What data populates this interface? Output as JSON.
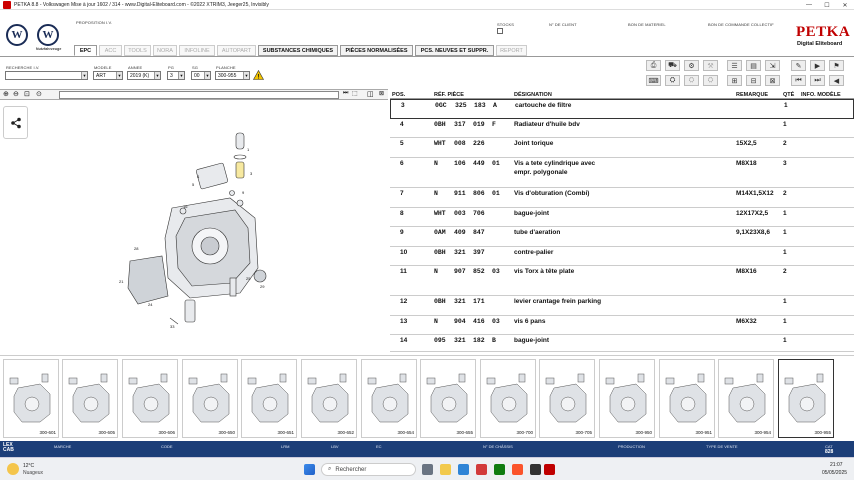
{
  "window": {
    "title": "PETKA 8.8 - Volkswagen Mise à jour 1602 / 314 - www.Digital-Eliteboard.com - ©2022 XTRIM3, Jeeger25, Invisibly"
  },
  "header": {
    "brand_name": "PETKA",
    "brand_sub": "Digital Eliteboard",
    "vw_sub": "Nutzfahrzeuge",
    "proposition": "PROPOSITION I.V.",
    "stocks": "STOCKS",
    "client_no": "N° DE CLIENT",
    "bon_materiel": "BON DE MATERIEL",
    "bon_commande": "BON DE COMMANDE COLLECTIF"
  },
  "tabs": [
    {
      "label": "EPC",
      "state": "active"
    },
    {
      "label": "ACC",
      "state": "disabled"
    },
    {
      "label": "TOOLS",
      "state": "disabled"
    },
    {
      "label": "NORA",
      "state": "disabled"
    },
    {
      "label": "INFOLINE",
      "state": "disabled"
    },
    {
      "label": "AUTOPART",
      "state": "disabled"
    },
    {
      "label": "SUBSTANCES CHIMIQUES",
      "state": "normal"
    },
    {
      "label": "PIÈCES NORMALISÉES",
      "state": "normal"
    },
    {
      "label": "PCS. NEUVES ET SUPPR.",
      "state": "normal"
    },
    {
      "label": "REPORT",
      "state": "disabled"
    }
  ],
  "filters": {
    "recherche_label": "RECHERCHE I.V.",
    "modele_label": "MODELE",
    "modele_value": "ART",
    "annee_label": "ANNEE",
    "annee_value": "2019 (K)",
    "pg_label": "PG",
    "pg_value": "3",
    "sg_label": "SG",
    "sg_value": "00",
    "planche_label": "PLANCHE",
    "planche_value": "300-955"
  },
  "table": {
    "headers": {
      "pos": "POS.",
      "ref": "RÉF. PIÈCE",
      "designation": "DÉSIGNATION",
      "remarque": "REMARQUE",
      "qte": "QTÉ",
      "info": "INFO. MODÈLE"
    },
    "rows": [
      {
        "pos": "3",
        "r1": "0GC",
        "r2": "325",
        "r3": "183",
        "r4": "A",
        "des": "cartouche de filtre",
        "des2": "",
        "rem": "",
        "qte": "1"
      },
      {
        "pos": "4",
        "r1": "0BH",
        "r2": "317",
        "r3": "019",
        "r4": "F",
        "des": "Radiateur d'huile bdv",
        "des2": "",
        "rem": "",
        "qte": "1"
      },
      {
        "pos": "5",
        "r1": "WHT",
        "r2": "008",
        "r3": "226",
        "r4": "",
        "des": "Joint torique",
        "des2": "",
        "rem": "15X2,5",
        "qte": "2"
      },
      {
        "pos": "6",
        "r1": "N",
        "r2": "106",
        "r3": "449",
        "r4": "01",
        "des": "Vis a tete cylindrique avec",
        "des2": "empr. polygonale",
        "rem": "M8X18",
        "qte": "3"
      },
      {
        "pos": "7",
        "r1": "N",
        "r2": "911",
        "r3": "806",
        "r4": "01",
        "des": "Vis d'obturation (Combi)",
        "des2": "",
        "rem": "M14X1,5X12",
        "qte": "2"
      },
      {
        "pos": "8",
        "r1": "WHT",
        "r2": "003",
        "r3": "706",
        "r4": "",
        "des": "bague-joint",
        "des2": "",
        "rem": "12X17X2,5",
        "qte": "1"
      },
      {
        "pos": "9",
        "r1": "0AM",
        "r2": "409",
        "r3": "847",
        "r4": "",
        "des": "tube d'aeration",
        "des2": "",
        "rem": "9,1X23X8,6",
        "qte": "1"
      },
      {
        "pos": "10",
        "r1": "0BH",
        "r2": "321",
        "r3": "397",
        "r4": "",
        "des": "contre-palier",
        "des2": "",
        "rem": "",
        "qte": "1"
      },
      {
        "pos": "11",
        "r1": "N",
        "r2": "907",
        "r3": "852",
        "r4": "03",
        "des": "vis Torx à tête plate",
        "des2": "",
        "rem": "M8X16",
        "qte": "2"
      },
      {
        "pos": "12",
        "r1": "0BH",
        "r2": "321",
        "r3": "171",
        "r4": "",
        "des": "levier crantage frein parking",
        "des2": "",
        "rem": "",
        "qte": "1"
      },
      {
        "pos": "13",
        "r1": "N",
        "r2": "904",
        "r3": "416",
        "r4": "03",
        "des": "vis 6 pans",
        "des2": "",
        "rem": "M6X32",
        "qte": "1"
      },
      {
        "pos": "14",
        "r1": "095",
        "r2": "321",
        "r3": "182",
        "r4": "B",
        "des": "bague-joint",
        "des2": "",
        "rem": "",
        "qte": "1"
      }
    ]
  },
  "thumbnails": [
    "300-601",
    "300-605",
    "300-606",
    "300-650",
    "300-651",
    "300-652",
    "300-654",
    "300-655",
    "300-700",
    "300-705",
    "300-950",
    "300-951",
    "300-954",
    "300-955"
  ],
  "statusbar": {
    "marche": "MARCHE",
    "code": "CODE",
    "lrm": "LRM",
    "lbv": "LBV",
    "ec": "EC",
    "chassis": "N° DE CHÂSSIS",
    "production": "PRODUCTION",
    "type_vente": "TYPE DE VENTE",
    "cat_label": "CAT",
    "cat_value": "828",
    "fin_left": "LEX\nCAB"
  },
  "taskbar": {
    "temp": "12°C",
    "weather": "Nuageux",
    "search_placeholder": "Rechercher",
    "time": "21:07",
    "date": "05/05/2025"
  },
  "colors": {
    "statusbar": "#1c3e78",
    "vw_blue": "#1a2c56",
    "petka_red": "#c00000"
  }
}
